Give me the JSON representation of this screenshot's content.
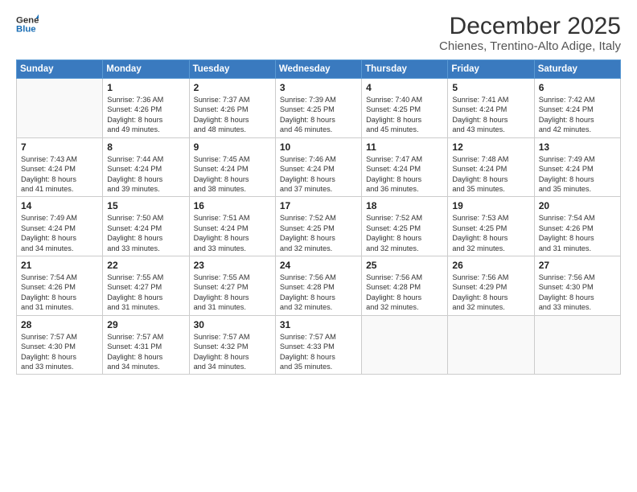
{
  "logo": {
    "line1": "General",
    "line2": "Blue"
  },
  "title": "December 2025",
  "subtitle": "Chienes, Trentino-Alto Adige, Italy",
  "weekdays": [
    "Sunday",
    "Monday",
    "Tuesday",
    "Wednesday",
    "Thursday",
    "Friday",
    "Saturday"
  ],
  "weeks": [
    [
      {
        "day": "",
        "info": ""
      },
      {
        "day": "1",
        "info": "Sunrise: 7:36 AM\nSunset: 4:26 PM\nDaylight: 8 hours\nand 49 minutes."
      },
      {
        "day": "2",
        "info": "Sunrise: 7:37 AM\nSunset: 4:26 PM\nDaylight: 8 hours\nand 48 minutes."
      },
      {
        "day": "3",
        "info": "Sunrise: 7:39 AM\nSunset: 4:25 PM\nDaylight: 8 hours\nand 46 minutes."
      },
      {
        "day": "4",
        "info": "Sunrise: 7:40 AM\nSunset: 4:25 PM\nDaylight: 8 hours\nand 45 minutes."
      },
      {
        "day": "5",
        "info": "Sunrise: 7:41 AM\nSunset: 4:24 PM\nDaylight: 8 hours\nand 43 minutes."
      },
      {
        "day": "6",
        "info": "Sunrise: 7:42 AM\nSunset: 4:24 PM\nDaylight: 8 hours\nand 42 minutes."
      }
    ],
    [
      {
        "day": "7",
        "info": "Sunrise: 7:43 AM\nSunset: 4:24 PM\nDaylight: 8 hours\nand 41 minutes."
      },
      {
        "day": "8",
        "info": "Sunrise: 7:44 AM\nSunset: 4:24 PM\nDaylight: 8 hours\nand 39 minutes."
      },
      {
        "day": "9",
        "info": "Sunrise: 7:45 AM\nSunset: 4:24 PM\nDaylight: 8 hours\nand 38 minutes."
      },
      {
        "day": "10",
        "info": "Sunrise: 7:46 AM\nSunset: 4:24 PM\nDaylight: 8 hours\nand 37 minutes."
      },
      {
        "day": "11",
        "info": "Sunrise: 7:47 AM\nSunset: 4:24 PM\nDaylight: 8 hours\nand 36 minutes."
      },
      {
        "day": "12",
        "info": "Sunrise: 7:48 AM\nSunset: 4:24 PM\nDaylight: 8 hours\nand 35 minutes."
      },
      {
        "day": "13",
        "info": "Sunrise: 7:49 AM\nSunset: 4:24 PM\nDaylight: 8 hours\nand 35 minutes."
      }
    ],
    [
      {
        "day": "14",
        "info": "Sunrise: 7:49 AM\nSunset: 4:24 PM\nDaylight: 8 hours\nand 34 minutes."
      },
      {
        "day": "15",
        "info": "Sunrise: 7:50 AM\nSunset: 4:24 PM\nDaylight: 8 hours\nand 33 minutes."
      },
      {
        "day": "16",
        "info": "Sunrise: 7:51 AM\nSunset: 4:24 PM\nDaylight: 8 hours\nand 33 minutes."
      },
      {
        "day": "17",
        "info": "Sunrise: 7:52 AM\nSunset: 4:25 PM\nDaylight: 8 hours\nand 32 minutes."
      },
      {
        "day": "18",
        "info": "Sunrise: 7:52 AM\nSunset: 4:25 PM\nDaylight: 8 hours\nand 32 minutes."
      },
      {
        "day": "19",
        "info": "Sunrise: 7:53 AM\nSunset: 4:25 PM\nDaylight: 8 hours\nand 32 minutes."
      },
      {
        "day": "20",
        "info": "Sunrise: 7:54 AM\nSunset: 4:26 PM\nDaylight: 8 hours\nand 31 minutes."
      }
    ],
    [
      {
        "day": "21",
        "info": "Sunrise: 7:54 AM\nSunset: 4:26 PM\nDaylight: 8 hours\nand 31 minutes."
      },
      {
        "day": "22",
        "info": "Sunrise: 7:55 AM\nSunset: 4:27 PM\nDaylight: 8 hours\nand 31 minutes."
      },
      {
        "day": "23",
        "info": "Sunrise: 7:55 AM\nSunset: 4:27 PM\nDaylight: 8 hours\nand 31 minutes."
      },
      {
        "day": "24",
        "info": "Sunrise: 7:56 AM\nSunset: 4:28 PM\nDaylight: 8 hours\nand 32 minutes."
      },
      {
        "day": "25",
        "info": "Sunrise: 7:56 AM\nSunset: 4:28 PM\nDaylight: 8 hours\nand 32 minutes."
      },
      {
        "day": "26",
        "info": "Sunrise: 7:56 AM\nSunset: 4:29 PM\nDaylight: 8 hours\nand 32 minutes."
      },
      {
        "day": "27",
        "info": "Sunrise: 7:56 AM\nSunset: 4:30 PM\nDaylight: 8 hours\nand 33 minutes."
      }
    ],
    [
      {
        "day": "28",
        "info": "Sunrise: 7:57 AM\nSunset: 4:30 PM\nDaylight: 8 hours\nand 33 minutes."
      },
      {
        "day": "29",
        "info": "Sunrise: 7:57 AM\nSunset: 4:31 PM\nDaylight: 8 hours\nand 34 minutes."
      },
      {
        "day": "30",
        "info": "Sunrise: 7:57 AM\nSunset: 4:32 PM\nDaylight: 8 hours\nand 34 minutes."
      },
      {
        "day": "31",
        "info": "Sunrise: 7:57 AM\nSunset: 4:33 PM\nDaylight: 8 hours\nand 35 minutes."
      },
      {
        "day": "",
        "info": ""
      },
      {
        "day": "",
        "info": ""
      },
      {
        "day": "",
        "info": ""
      }
    ]
  ]
}
